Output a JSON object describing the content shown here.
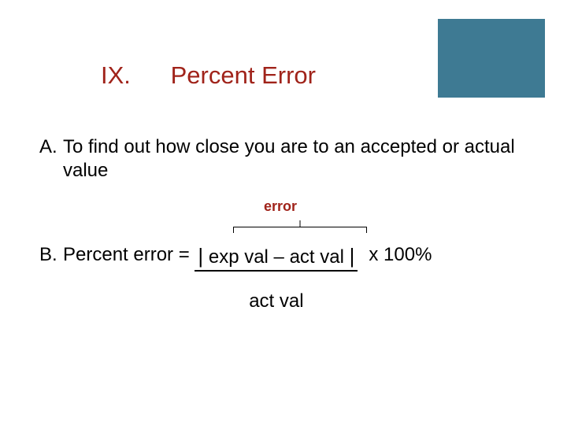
{
  "title": {
    "roman": "IX.",
    "text": "Percent Error"
  },
  "items": {
    "a": {
      "marker": "A.",
      "text": "To find out how close you are to an accepted or actual value"
    },
    "b": {
      "marker": "B.",
      "lead": "Percent error = ",
      "abs_open": "|",
      "numerator": " exp val – act val ",
      "abs_close": "|",
      "denominator": "act val",
      "times": "x 100%"
    }
  },
  "annotation": {
    "error_label": "error"
  }
}
